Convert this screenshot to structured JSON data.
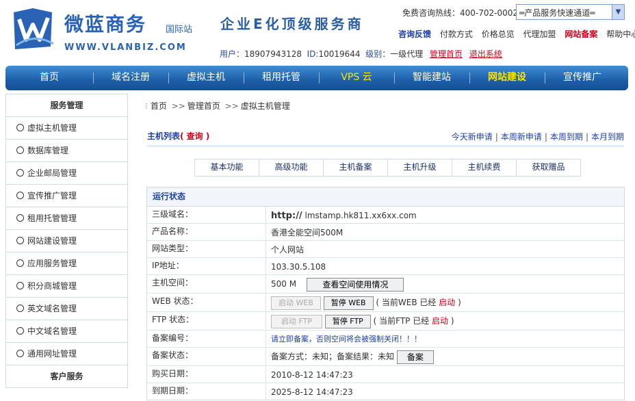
{
  "header": {
    "brand_cn": "微蓝商务",
    "brand_intl": "国际站",
    "brand_url": "WWW.VLANBIZ.COM",
    "slogan": "企业E化顶级服务商",
    "hotline": "免费咨询热线：400-702-0002",
    "quick_select": "═产品服务快速通道═",
    "links": {
      "consult": "咨询反馈",
      "pay": "付款方式",
      "price": "价格总览",
      "agent": "代理加盟",
      "beian": "网站备案",
      "help": "帮助中心"
    },
    "user": {
      "user_label": "用户：",
      "user_value": "18907943128",
      "id_label": "ID:",
      "id_value": "10019644",
      "level_label": "级别：",
      "level_value": "一级代理",
      "home": "管理首页",
      "logout": "退出系统"
    }
  },
  "nav": [
    "首页",
    "域名注册",
    "虚拟主机",
    "租用托管",
    "VPS 云",
    "智能建站",
    "网站建设",
    "宣传推广"
  ],
  "sidebar": {
    "head": "服务管理",
    "items": [
      "虚拟主机管理",
      "数据库管理",
      "企业邮局管理",
      "宣传推广管理",
      "租用托管管理",
      "网站建设管理",
      "应用服务管理",
      "积分商城管理",
      "英文域名管理",
      "中文域名管理",
      "通用网址管理"
    ],
    "head2": "客户服务"
  },
  "breadcrumb": {
    "a": "首页",
    "b": "管理首页",
    "c": "虚拟主机管理",
    "sep": ">>"
  },
  "list": {
    "title": "主机列表",
    "query": "( 查询 )",
    "periods": [
      "今天新申请",
      "本周新申请",
      "本周到期",
      "本月到期"
    ]
  },
  "tabs": [
    "基本功能",
    "高级功能",
    "主机备案",
    "主机升级",
    "主机续费",
    "获取赠品"
  ],
  "status": {
    "head": "运行状态",
    "domain_label": "三级域名：",
    "domain_prefix": "http://",
    "domain_value": "lmstamp.hk811.xx6xx.com",
    "product_label": "产品名称：",
    "product_value": "香港全能空间500M",
    "type_label": "网站类型：",
    "type_value": "个人网站",
    "ip_label": "IP地址：",
    "ip_value": "103.30.5.108",
    "space_label": "主机空间：",
    "space_value": "500 M",
    "space_btn": "查看空间使用情况",
    "web_label": "WEB 状态：",
    "web_start": "启动 WEB",
    "web_stop": "暂停 WEB",
    "web_note": "( 当前WEB 已经",
    "web_state": "启动",
    "web_close": ")",
    "ftp_label": "FTP 状态：",
    "ftp_start": "启动 FTP",
    "ftp_stop": "暂停 FTP",
    "ftp_note": "( 当前FTP 已经",
    "ftp_state": "启动",
    "ftp_close": ")",
    "beian_no_label": "备案编号：",
    "beian_no_value": "请立即备案，否则空间将会被强制关闭！！！",
    "beian_state_label": "备案状态：",
    "beian_state_value": "备案方式：未知；备案结果：未知",
    "beian_btn": "备案",
    "buy_label": "购买日期：",
    "buy_value": "2010-8-12 14:47:23",
    "expire_label": "到期日期：",
    "expire_value": "2025-8-12 14:47:23"
  },
  "colors": {
    "nav_top": "#3f8ed5",
    "nav_bottom": "#174e91",
    "accent_red": "#d0021b",
    "link_blue": "#1a3fa8",
    "nav_highlight": "#ffe500"
  }
}
